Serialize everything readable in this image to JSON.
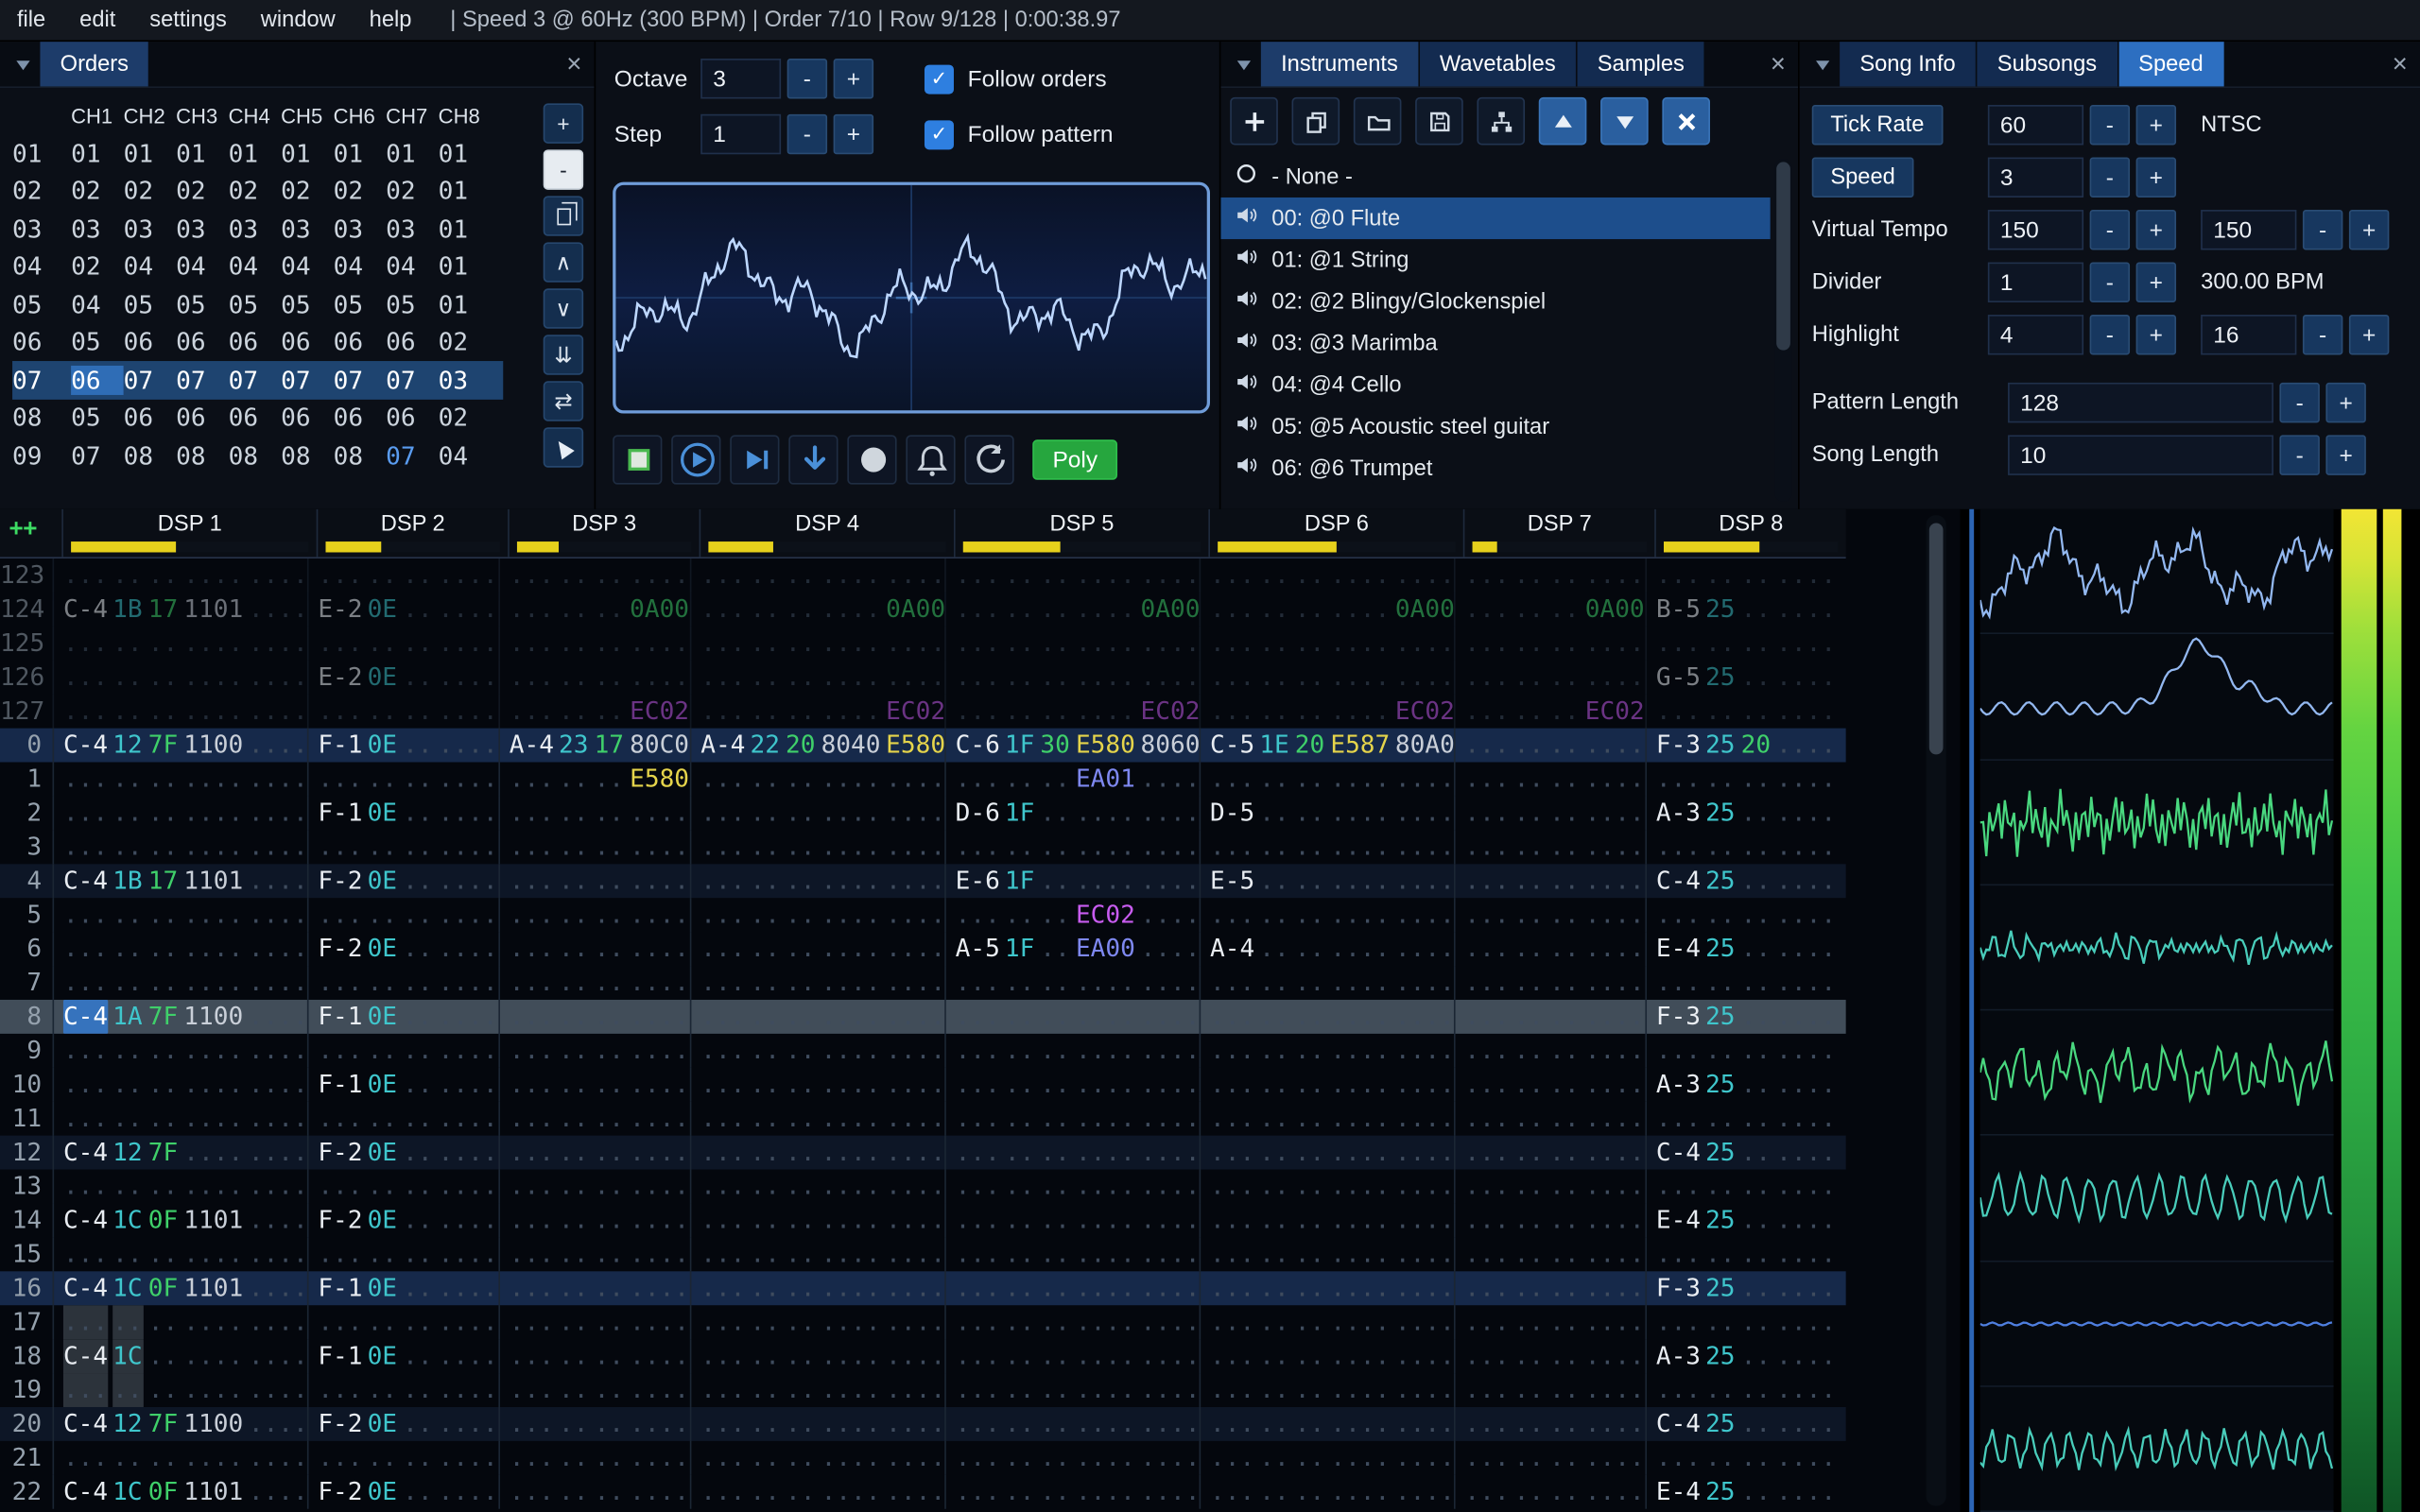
{
  "menu": {
    "items": [
      "file",
      "edit",
      "settings",
      "window",
      "help"
    ],
    "status": "| Speed 3 @ 60Hz (300 BPM) | Order 7/10 | Row 9/128 | 0:00:38.97"
  },
  "controls": {
    "octave_label": "Octave",
    "octave": "3",
    "step_label": "Step",
    "step": "1",
    "follow_orders": "Follow orders",
    "follow_pattern": "Follow pattern",
    "minus": "-",
    "plus": "+",
    "poly": "Poly"
  },
  "orders": {
    "title": "Orders",
    "columns": [
      "CH1",
      "CH2",
      "CH3",
      "CH4",
      "CH5",
      "CH6",
      "CH7",
      "CH8"
    ],
    "rows": [
      {
        "n": "01",
        "v": [
          "01",
          "01",
          "01",
          "01",
          "01",
          "01",
          "01",
          "01"
        ]
      },
      {
        "n": "02",
        "v": [
          "02",
          "02",
          "02",
          "02",
          "02",
          "02",
          "02",
          "01"
        ]
      },
      {
        "n": "03",
        "v": [
          "03",
          "03",
          "03",
          "03",
          "03",
          "03",
          "03",
          "01"
        ]
      },
      {
        "n": "04",
        "v": [
          "02",
          "04",
          "04",
          "04",
          "04",
          "04",
          "04",
          "01"
        ]
      },
      {
        "n": "05",
        "v": [
          "04",
          "05",
          "05",
          "05",
          "05",
          "05",
          "05",
          "01"
        ]
      },
      {
        "n": "06",
        "v": [
          "05",
          "06",
          "06",
          "06",
          "06",
          "06",
          "06",
          "02"
        ]
      },
      {
        "n": "07",
        "v": [
          "06",
          "07",
          "07",
          "07",
          "07",
          "07",
          "07",
          "03"
        ],
        "current": true
      },
      {
        "n": "08",
        "v": [
          "05",
          "06",
          "06",
          "06",
          "06",
          "06",
          "06",
          "02"
        ]
      },
      {
        "n": "09",
        "v": [
          "07",
          "08",
          "08",
          "08",
          "08",
          "08",
          "07",
          "04"
        ],
        "alt": [
          6
        ]
      }
    ],
    "buttons": [
      {
        "name": "add-order-button",
        "glyph": "+"
      },
      {
        "name": "remove-order-button",
        "glyph": "-",
        "light": true
      },
      {
        "name": "duplicate-order-button",
        "glyph": "#copy"
      },
      {
        "name": "move-order-up-button",
        "glyph": "∧"
      },
      {
        "name": "move-order-down-button",
        "glyph": "∨"
      },
      {
        "name": "duplicate-order-end-button",
        "glyph": "⇊"
      },
      {
        "name": "exchange-orders-button",
        "glyph": "⇄"
      },
      {
        "name": "order-change-mode-button",
        "glyph": "#pointer"
      }
    ]
  },
  "instruments": {
    "tabs": [
      {
        "label": "Instruments",
        "semi": true
      },
      {
        "label": "Wavetables"
      },
      {
        "label": "Samples"
      }
    ],
    "none_label": "- None -",
    "items": [
      {
        "label": "00: @0 Flute",
        "selected": true
      },
      {
        "label": "01: @1 String"
      },
      {
        "label": "02: @2 Blingy/Glockenspiel"
      },
      {
        "label": "03: @3 Marimba"
      },
      {
        "label": "04: @4 Cello"
      },
      {
        "label": "05: @5 Acoustic steel guitar"
      },
      {
        "label": "06: @6 Trumpet"
      }
    ]
  },
  "speed_window": {
    "tabs": [
      {
        "label": "Song Info"
      },
      {
        "label": "Subsongs"
      },
      {
        "label": "Speed",
        "active": true
      }
    ],
    "tick_rate": {
      "label": "Tick Rate",
      "value": "60",
      "suffix": "NTSC"
    },
    "speed": {
      "label": "Speed",
      "value": "3"
    },
    "virtual_tempo": {
      "label": "Virtual Tempo",
      "value1": "150",
      "value2": "150"
    },
    "divider": {
      "label": "Divider",
      "value": "1",
      "suffix": "300.00 BPM"
    },
    "highlight": {
      "label": "Highlight",
      "value1": "4",
      "value2": "16"
    },
    "pattern_length": {
      "label": "Pattern Length",
      "value": "128"
    },
    "song_length": {
      "label": "Song Length",
      "value": "10"
    }
  },
  "pattern": {
    "corner": "++",
    "channels": [
      {
        "name": "DSP 1",
        "fx": 2,
        "meter": 0.44
      },
      {
        "name": "DSP 2",
        "fx": 1,
        "meter": 0.32
      },
      {
        "name": "DSP 3",
        "fx": 1,
        "meter": 0.24
      },
      {
        "name": "DSP 4",
        "fx": 2,
        "meter": 0.27
      },
      {
        "name": "DSP 5",
        "fx": 2,
        "meter": 0.41
      },
      {
        "name": "DSP 6",
        "fx": 2,
        "meter": 0.5
      },
      {
        "name": "DSP 7",
        "fx": 1,
        "meter": 0.14
      },
      {
        "name": "DSP 8",
        "fx": 1,
        "meter": 0.55
      }
    ],
    "cursor": {
      "row": "8",
      "ch": 0
    },
    "selection": {
      "rows": [
        "17",
        "18",
        "19"
      ],
      "ch": 0
    },
    "colors": {
      "note": "#e9edf2",
      "ins": "#3fc6cc",
      "vol": "#3fd06a",
      "empty": "#3f4c5e",
      "fx_default": "#c9cfd8",
      "fx": {
        "0A": "#3fd06a",
        "EC": "#c85cf0",
        "E5": "#e5d44b",
        "EA": "#7e88f0"
      }
    },
    "rows": [
      {
        "n": "123",
        "dim": 1,
        "cells": [
          0,
          0,
          0,
          0,
          0,
          0,
          0,
          0
        ]
      },
      {
        "n": "124",
        "dim": 1,
        "cells": [
          [
            "C-4",
            "1B",
            "17",
            "1101",
            ""
          ],
          [
            "E-2",
            "0E",
            "",
            ""
          ],
          [
            "",
            "",
            "",
            "0A00"
          ],
          [
            "",
            "",
            "",
            "",
            "0A00"
          ],
          [
            "",
            "",
            "",
            "",
            "0A00"
          ],
          [
            "",
            "",
            "",
            "",
            "0A00"
          ],
          [
            "",
            "",
            "",
            "0A00"
          ],
          [
            "B-5",
            "25",
            "",
            ""
          ]
        ]
      },
      {
        "n": "125",
        "dim": 1,
        "cells": [
          0,
          0,
          0,
          0,
          0,
          0,
          0,
          0
        ]
      },
      {
        "n": "126",
        "dim": 1,
        "cells": [
          0,
          [
            "E-2",
            "0E",
            "",
            ""
          ],
          0,
          0,
          0,
          0,
          0,
          [
            "G-5",
            "25",
            "",
            ""
          ]
        ]
      },
      {
        "n": "127",
        "dim": 1,
        "cells": [
          0,
          0,
          [
            "",
            "",
            "",
            "EC02"
          ],
          [
            "",
            "",
            "",
            "",
            "EC02"
          ],
          [
            "",
            "",
            "",
            "",
            "EC02"
          ],
          [
            "",
            "",
            "",
            "",
            "EC02"
          ],
          [
            "",
            "",
            "",
            "EC02"
          ],
          0
        ]
      },
      {
        "n": "0",
        "hl": 2,
        "cells": [
          [
            "C-4",
            "12",
            "7F",
            "1100",
            ""
          ],
          [
            "F-1",
            "0E",
            "",
            ""
          ],
          [
            "A-4",
            "23",
            "17",
            "80C0"
          ],
          [
            "A-4",
            "22",
            "20",
            "8040",
            "E580"
          ],
          [
            "C-6",
            "1F",
            "30",
            "E580",
            "8060"
          ],
          [
            "C-5",
            "1E",
            "20",
            "E587",
            "80A0"
          ],
          0,
          [
            "F-3",
            "25",
            "20",
            ""
          ]
        ]
      },
      {
        "n": "1",
        "cells": [
          0,
          0,
          [
            "",
            "",
            "",
            "E580"
          ],
          0,
          [
            "",
            "",
            "",
            "EA01",
            ""
          ],
          0,
          0,
          0
        ]
      },
      {
        "n": "2",
        "cells": [
          0,
          [
            "F-1",
            "0E",
            "",
            ""
          ],
          0,
          0,
          [
            "D-6",
            "1F",
            "",
            "",
            ""
          ],
          [
            "D-5",
            "",
            "",
            "",
            ""
          ],
          0,
          [
            "A-3",
            "25",
            "",
            ""
          ]
        ]
      },
      {
        "n": "3",
        "cells": [
          0,
          0,
          0,
          0,
          0,
          0,
          0,
          0
        ]
      },
      {
        "n": "4",
        "hl": 1,
        "cells": [
          [
            "C-4",
            "1B",
            "17",
            "1101",
            ""
          ],
          [
            "F-2",
            "0E",
            "",
            ""
          ],
          0,
          0,
          [
            "E-6",
            "1F",
            "",
            "",
            ""
          ],
          [
            "E-5",
            "",
            "",
            "",
            ""
          ],
          0,
          [
            "C-4",
            "25",
            "",
            ""
          ]
        ]
      },
      {
        "n": "5",
        "cells": [
          0,
          0,
          0,
          0,
          [
            "",
            "",
            "",
            "EC02",
            ""
          ],
          0,
          0,
          0
        ]
      },
      {
        "n": "6",
        "cells": [
          0,
          [
            "F-2",
            "0E",
            "",
            ""
          ],
          0,
          0,
          [
            "A-5",
            "1F",
            "",
            "EA00",
            ""
          ],
          [
            "A-4",
            "",
            "",
            "",
            ""
          ],
          0,
          [
            "E-4",
            "25",
            "",
            ""
          ]
        ]
      },
      {
        "n": "7",
        "cells": [
          0,
          0,
          0,
          0,
          0,
          0,
          0,
          0
        ]
      },
      {
        "n": "8",
        "hl": 1,
        "play": 1,
        "cells": [
          [
            "C-4",
            "1A",
            "7F",
            "1100",
            ""
          ],
          [
            "F-1",
            "0E",
            "",
            ""
          ],
          0,
          0,
          0,
          0,
          0,
          [
            "F-3",
            "25",
            "",
            ""
          ]
        ]
      },
      {
        "n": "9",
        "cells": [
          0,
          0,
          0,
          0,
          0,
          0,
          0,
          0
        ]
      },
      {
        "n": "10",
        "cells": [
          0,
          [
            "F-1",
            "0E",
            "",
            ""
          ],
          0,
          0,
          0,
          0,
          0,
          [
            "A-3",
            "25",
            "",
            ""
          ]
        ]
      },
      {
        "n": "11",
        "cells": [
          0,
          0,
          0,
          0,
          0,
          0,
          0,
          0
        ]
      },
      {
        "n": "12",
        "hl": 1,
        "cells": [
          [
            "C-4",
            "12",
            "7F",
            "",
            ""
          ],
          [
            "F-2",
            "0E",
            "",
            ""
          ],
          0,
          0,
          0,
          0,
          0,
          [
            "C-4",
            "25",
            "",
            ""
          ]
        ]
      },
      {
        "n": "13",
        "cells": [
          0,
          0,
          0,
          0,
          0,
          0,
          0,
          0
        ]
      },
      {
        "n": "14",
        "cells": [
          [
            "C-4",
            "1C",
            "0F",
            "1101",
            ""
          ],
          [
            "F-2",
            "0E",
            "",
            ""
          ],
          0,
          0,
          0,
          0,
          0,
          [
            "E-4",
            "25",
            "",
            ""
          ]
        ]
      },
      {
        "n": "15",
        "cells": [
          0,
          0,
          0,
          0,
          0,
          0,
          0,
          0
        ]
      },
      {
        "n": "16",
        "hl": 2,
        "cells": [
          [
            "C-4",
            "1C",
            "0F",
            "1101",
            ""
          ],
          [
            "F-1",
            "0E",
            "",
            ""
          ],
          0,
          0,
          0,
          0,
          0,
          [
            "F-3",
            "25",
            "",
            ""
          ]
        ]
      },
      {
        "n": "17",
        "cells": [
          0,
          0,
          0,
          0,
          0,
          0,
          0,
          0
        ]
      },
      {
        "n": "18",
        "cells": [
          [
            "C-4",
            "1C",
            "",
            "",
            ""
          ],
          [
            "F-1",
            "0E",
            "",
            ""
          ],
          0,
          0,
          0,
          0,
          0,
          [
            "A-3",
            "25",
            "",
            ""
          ]
        ]
      },
      {
        "n": "19",
        "cells": [
          0,
          0,
          0,
          0,
          0,
          0,
          0,
          0
        ]
      },
      {
        "n": "20",
        "hl": 1,
        "cells": [
          [
            "C-4",
            "12",
            "7F",
            "1100",
            ""
          ],
          [
            "F-2",
            "0E",
            "",
            ""
          ],
          0,
          0,
          0,
          0,
          0,
          [
            "C-4",
            "25",
            "",
            ""
          ]
        ]
      },
      {
        "n": "21",
        "cells": [
          0,
          0,
          0,
          0,
          0,
          0,
          0,
          0
        ]
      },
      {
        "n": "22",
        "cells": [
          [
            "C-4",
            "1C",
            "0F",
            "1101",
            ""
          ],
          [
            "F-2",
            "0E",
            "",
            ""
          ],
          0,
          0,
          0,
          0,
          0,
          [
            "E-4",
            "25",
            "",
            ""
          ]
        ]
      }
    ]
  },
  "scopes": {
    "items": [
      {
        "name": "dsp1",
        "color": "#93b8f0",
        "kind": "flute"
      },
      {
        "name": "dsp2",
        "color": "#93b8f0",
        "kind": "string"
      },
      {
        "name": "dsp3",
        "color": "#49d87f",
        "kind": "dense"
      },
      {
        "name": "dsp4",
        "color": "#49cdbb",
        "kind": "ripple"
      },
      {
        "name": "dsp5",
        "color": "#49d87f",
        "kind": "dense2"
      },
      {
        "name": "dsp6",
        "color": "#49cdbb",
        "kind": "sine"
      },
      {
        "name": "dsp7",
        "color": "#4f7fe0",
        "kind": "flat"
      },
      {
        "name": "dsp8",
        "color": "#49cdbb",
        "kind": "sine2"
      }
    ]
  },
  "osc": {
    "color": "#bdd7ff"
  }
}
